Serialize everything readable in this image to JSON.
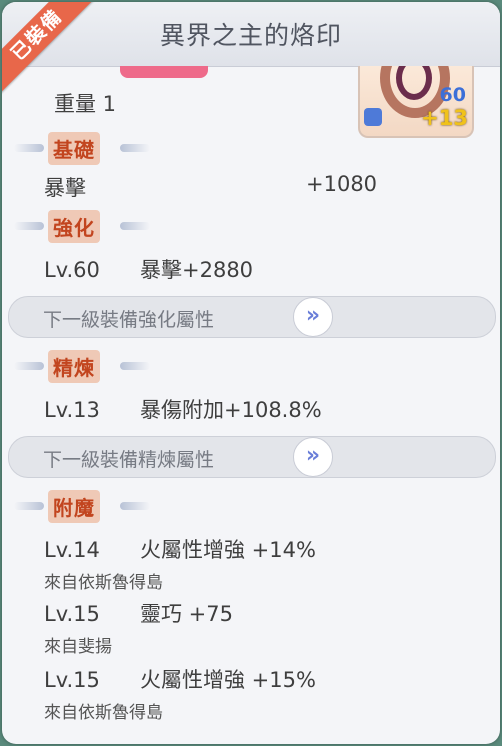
{
  "title": "異界之主的烙印",
  "equipped_badge": "已裝備",
  "item_icon": {
    "number": "60",
    "plus": "+13"
  },
  "weight": "重量 1",
  "sections": {
    "base": {
      "label": "基礎",
      "stat": "暴擊",
      "value": "+1080"
    },
    "enhance": {
      "label": "強化",
      "level": "Lv.60",
      "effect": "暴擊+2880",
      "next_label": "下一級裝備強化屬性"
    },
    "refine": {
      "label": "精煉",
      "level": "Lv.13",
      "effect": "暴傷附加+108.8%",
      "next_label": "下一級裝備精煉屬性"
    },
    "enchant": {
      "label": "附魔",
      "entries": [
        {
          "level": "Lv.14",
          "effect": "火屬性增強 +14%",
          "source": "來自依斯魯得島"
        },
        {
          "level": "Lv.15",
          "effect": "靈巧 +75",
          "source": "來自斐揚"
        },
        {
          "level": "Lv.15",
          "effect": "火屬性增強 +15%",
          "source": "來自依斯魯得島"
        }
      ]
    }
  },
  "colors": {
    "section_label": "#c2451f",
    "ribbon": "#e8674a",
    "icon_number": "#3c6fd8",
    "icon_plus": "#f0c21a"
  }
}
